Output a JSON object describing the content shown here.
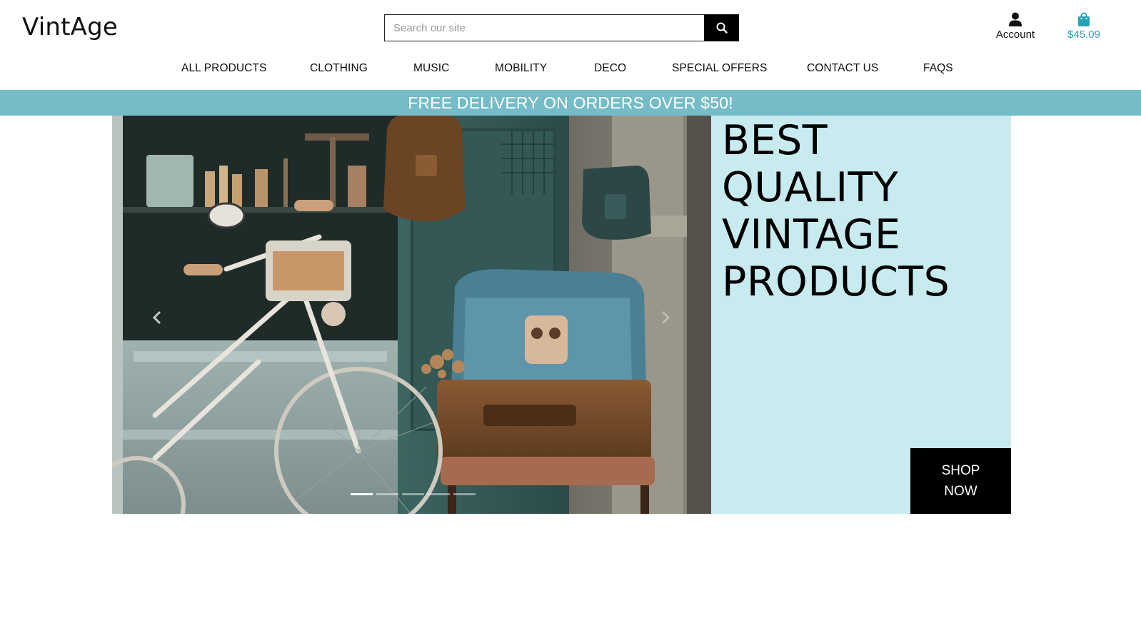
{
  "header": {
    "logo": "VintAge",
    "search": {
      "placeholder": "Search our site",
      "button_icon": "search-icon"
    },
    "account_label": "Account",
    "cart_total": "$45.09"
  },
  "nav": {
    "items": [
      "ALL PRODUCTS",
      "CLOTHING",
      "MUSIC",
      "MOBILITY",
      "DECO",
      "SPECIAL OFFERS",
      "CONTACT US",
      "FAQS"
    ]
  },
  "promo": {
    "text": "FREE DELIVERY ON ORDERS OVER $50!"
  },
  "hero": {
    "title": "BEST QUALITY VINTAGE PRODUCTS",
    "cta": "SHOP NOW",
    "carousel": {
      "slides": 5,
      "active_slide": 1
    }
  },
  "colors": {
    "promo_bar": "#76bcc8",
    "hero_panel": "#c8ebef",
    "cart_accent": "#2aa2b6",
    "cta_bg": "#000000"
  }
}
